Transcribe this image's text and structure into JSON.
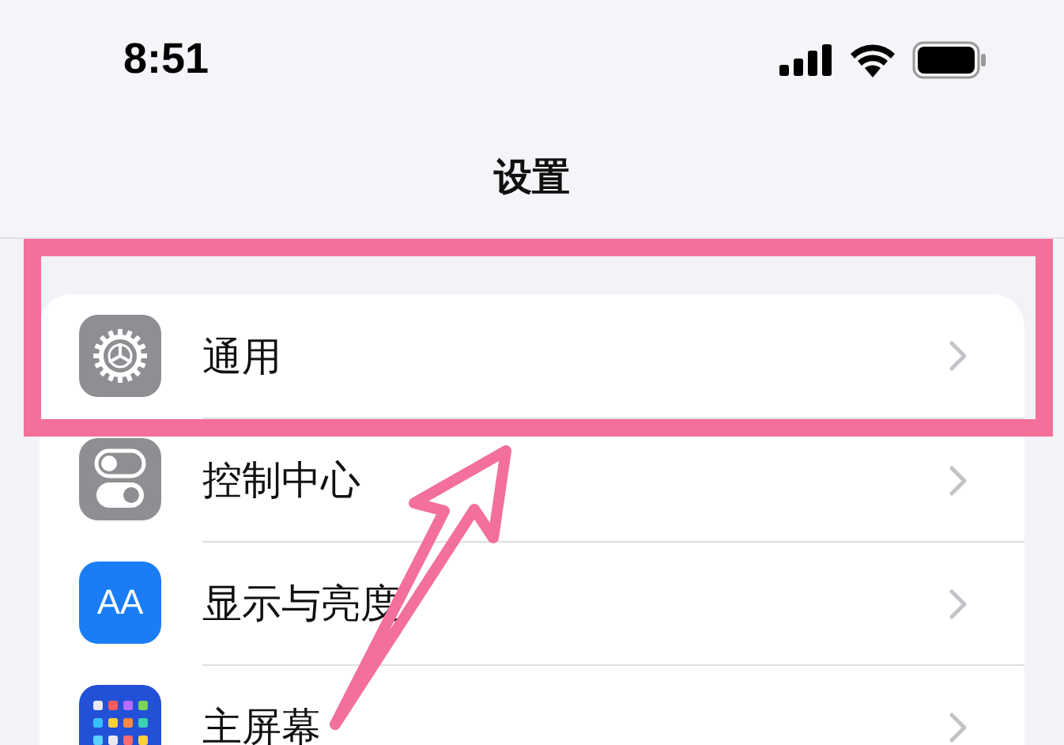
{
  "status_bar": {
    "time": "8:51"
  },
  "nav": {
    "title": "设置"
  },
  "rows": [
    {
      "label": "通用",
      "kind": "gear",
      "highlighted": true
    },
    {
      "label": "控制中心",
      "kind": "toggles",
      "highlighted": false
    },
    {
      "label": "显示与亮度",
      "kind": "text",
      "icon_text": "AA",
      "highlighted": false
    },
    {
      "label": "主屏幕",
      "kind": "grid",
      "highlighted": false
    }
  ]
}
